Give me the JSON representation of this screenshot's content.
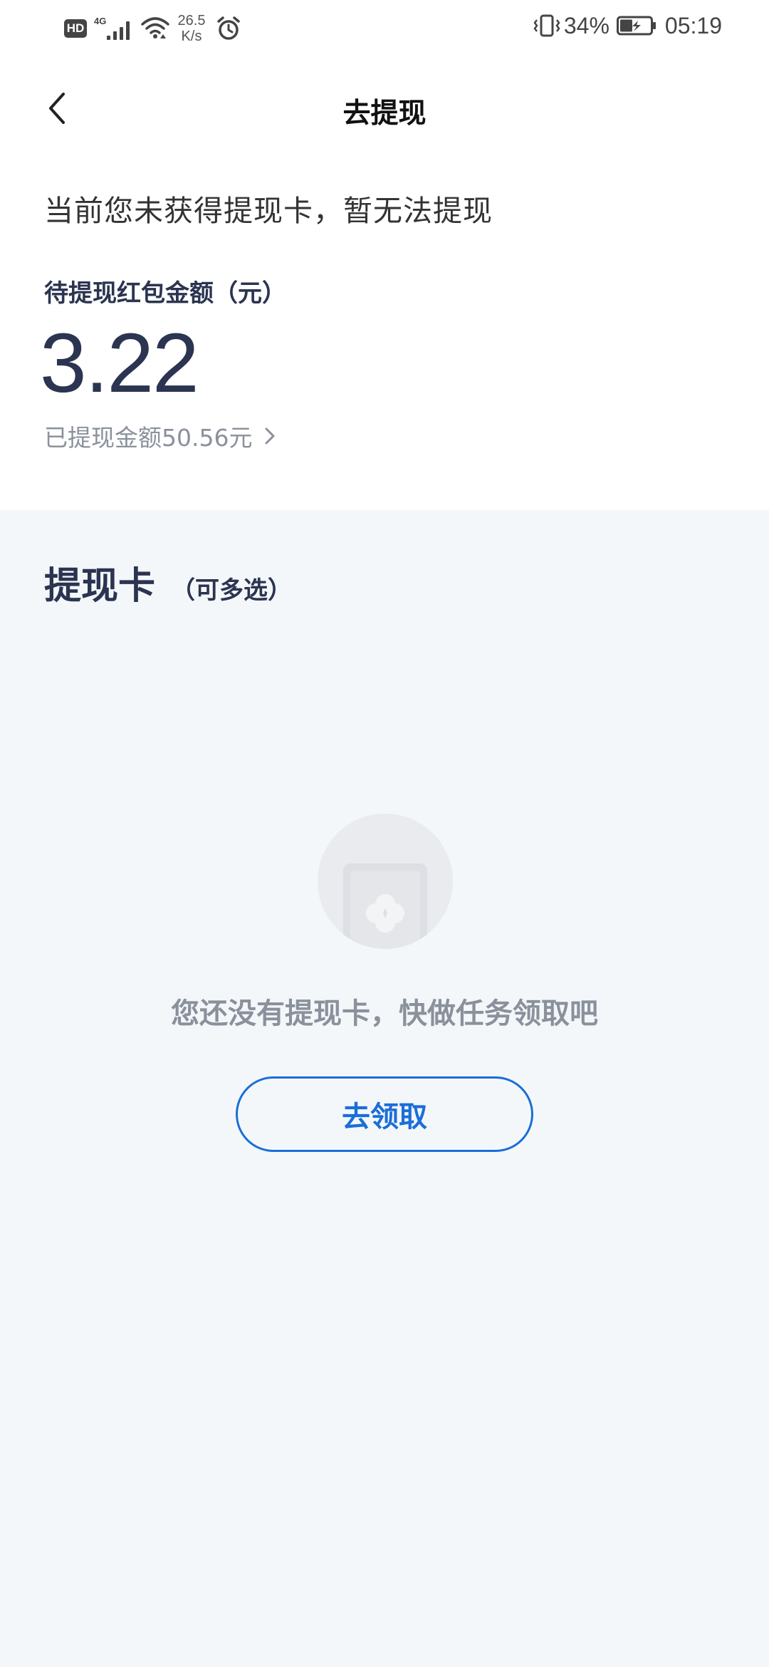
{
  "status_bar": {
    "hd_badge": "HD",
    "network_tag": "4G",
    "speed_value": "26.5",
    "speed_unit": "K/s",
    "battery_percent": "34%",
    "time": "05:19"
  },
  "nav": {
    "title": "去提现",
    "back_icon": "chevron-left-icon"
  },
  "notice": "当前您未获得提现卡，暂无法提现",
  "amount": {
    "label": "待提现红包金额（元）",
    "value": "3.22",
    "withdrawn_text": "已提现金额50.56元"
  },
  "cards_section": {
    "title": "提现卡",
    "subtitle": "（可多选）",
    "empty_text": "您还没有提现卡，快做任务领取吧",
    "action_label": "去领取"
  },
  "colors": {
    "primary_text": "#2b3450",
    "secondary_text": "#8a919c",
    "accent": "#1a6ed8",
    "page_background": "#f4f7fa"
  }
}
